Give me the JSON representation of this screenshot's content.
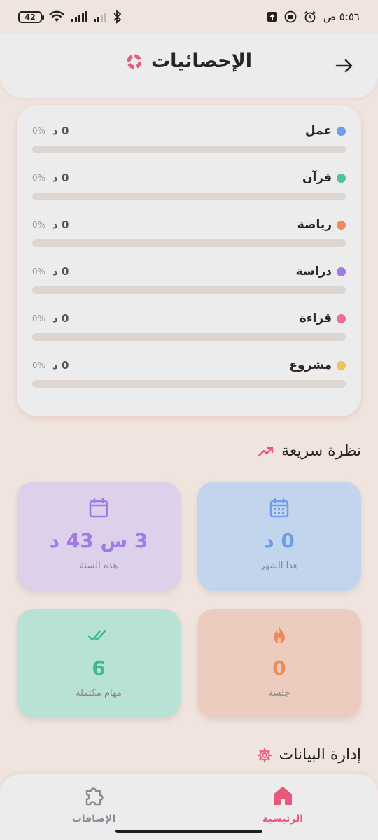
{
  "status_bar": {
    "battery": "42",
    "time": "٥:٥٦ ص"
  },
  "header": {
    "title": "الإحصائيات",
    "back_icon": "arrow-right-icon",
    "title_icon": "donut-chart-icon"
  },
  "categories": [
    {
      "name": "عمل",
      "duration": "0 د",
      "percent": "0%",
      "progress": 0,
      "color": "#6f9ee6"
    },
    {
      "name": "قرآن",
      "duration": "0 د",
      "percent": "0%",
      "progress": 0,
      "color": "#4fc3a1"
    },
    {
      "name": "رياضة",
      "duration": "0 د",
      "percent": "0%",
      "progress": 0,
      "color": "#ef8a5c"
    },
    {
      "name": "دراسة",
      "duration": "0 د",
      "percent": "0%",
      "progress": 0,
      "color": "#a07ae6"
    },
    {
      "name": "قراءة",
      "duration": "0 د",
      "percent": "0%",
      "progress": 0,
      "color": "#ea7090"
    },
    {
      "name": "مشروع",
      "duration": "0 د",
      "percent": "0%",
      "progress": 0,
      "color": "#eec25a"
    }
  ],
  "quick_view": {
    "title": "نظرة سريعة",
    "icon": "trending-up-icon",
    "cards": [
      {
        "id": "month",
        "value": "0 د",
        "label": "هذا الشهر",
        "icon": "calendar-grid-icon",
        "bg": "#c3d5ec",
        "color": "#6f9ee6"
      },
      {
        "id": "year",
        "value": "3 س 43 د",
        "label": "هذه السنة",
        "icon": "calendar-icon",
        "bg": "#ddd0ea",
        "color": "#a07ae6"
      },
      {
        "id": "sessions",
        "value": "0",
        "label": "جلسة",
        "icon": "fire-icon",
        "bg": "#ecccbf",
        "color": "#ef8a5c"
      },
      {
        "id": "tasks",
        "value": "6",
        "label": "مهام مكتملة",
        "icon": "double-check-icon",
        "bg": "#b8e2d4",
        "color": "#3fb894"
      }
    ]
  },
  "data_management": {
    "title": "إدارة البيانات",
    "icon": "gear-icon"
  },
  "bottom_nav": {
    "items": [
      {
        "label": "الرئيسية",
        "icon": "home-icon",
        "active": true,
        "color": "#e8587a"
      },
      {
        "label": "الإضافات",
        "icon": "puzzle-icon",
        "active": false,
        "color": "#8a8a96"
      }
    ]
  },
  "colors": {
    "background": "#f0e4de",
    "card": "#ececec",
    "accent": "#e8587a"
  }
}
